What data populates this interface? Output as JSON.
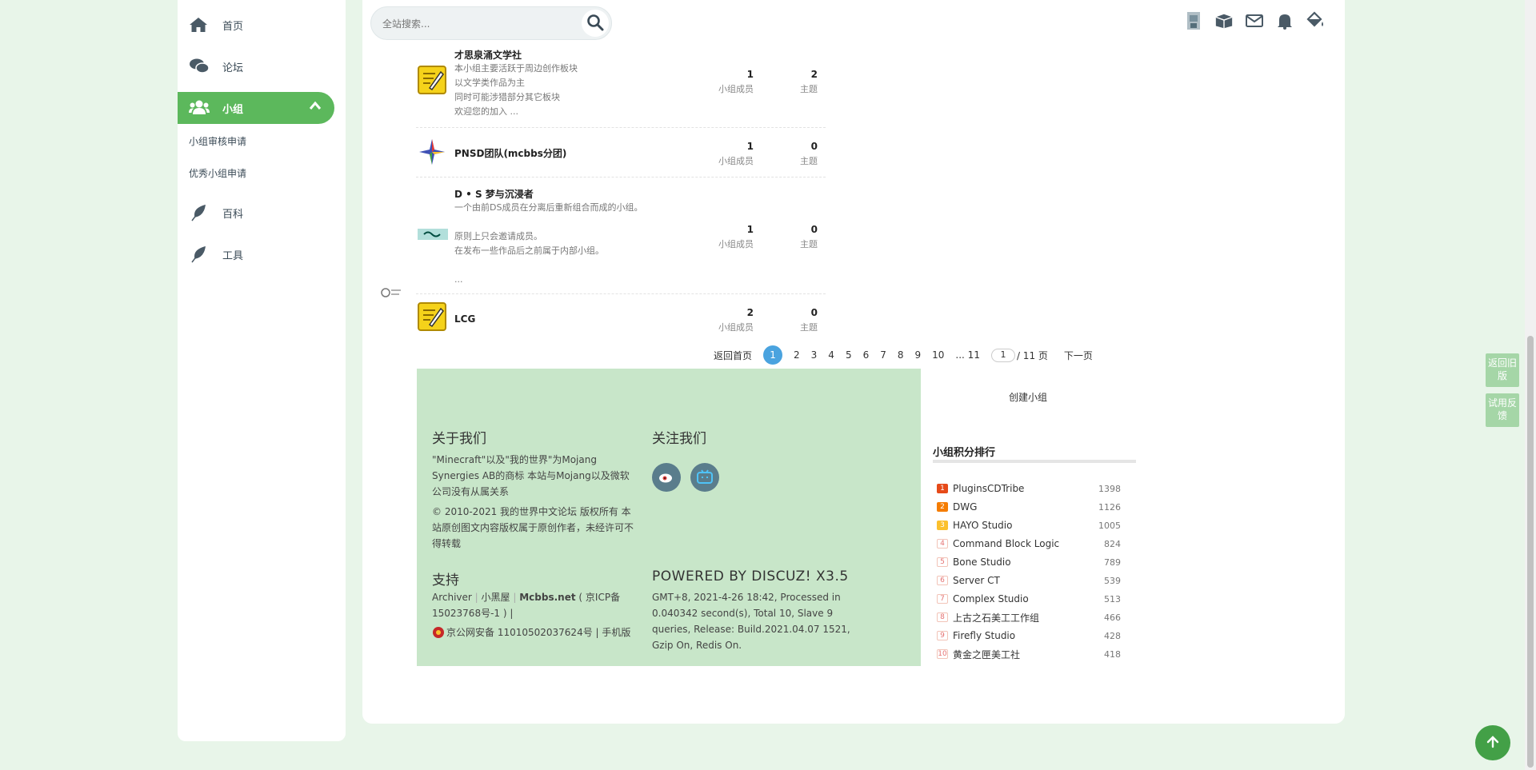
{
  "sidebar": {
    "items": [
      {
        "label": "首页",
        "icon": "home-icon"
      },
      {
        "label": "论坛",
        "icon": "chat-icon"
      },
      {
        "label": "小组",
        "icon": "users-icon"
      },
      {
        "label": "百科",
        "icon": "feather-icon"
      },
      {
        "label": "工具",
        "icon": "feather-icon"
      }
    ],
    "subitems": [
      "小组审核申请",
      "优秀小组申请"
    ]
  },
  "search": {
    "placeholder": "全站搜索..."
  },
  "groups": [
    {
      "name": "才思泉涌文学社",
      "desc": "本小组主要活跃于周边创作板块\n以文学类作品为主\n同时可能涉猎部分其它板块\n欢迎您的加入 ...",
      "members": "1",
      "members_label": "小组成员",
      "topics": "2",
      "topics_label": "主题"
    },
    {
      "name": "PNSD团队(mcbbs分团)",
      "desc": "",
      "members": "1",
      "members_label": "小组成员",
      "topics": "0",
      "topics_label": "主题"
    },
    {
      "name": "D • S 梦与沉浸者",
      "desc": "一个由前DS成员在分离后重新组合而成的小组。\n\n原则上只会邀请成员。\n在发布一些作品后之前属于内部小组。\n\n...",
      "members": "1",
      "members_label": "小组成员",
      "topics": "0",
      "topics_label": "主题"
    },
    {
      "name": "LCG",
      "desc": "",
      "members": "2",
      "members_label": "小组成员",
      "topics": "0",
      "topics_label": "主题"
    }
  ],
  "pager": {
    "home": "返回首页",
    "current": "1",
    "pages": [
      "2",
      "3",
      "4",
      "5",
      "6",
      "7",
      "8",
      "9",
      "10"
    ],
    "last": "... 11",
    "input_value": "1",
    "total": "/ 11 页",
    "next": "下一页"
  },
  "footer": {
    "about_title": "关于我们",
    "about_text1": "\"Minecraft\"以及\"我的世界\"为Mojang Synergies AB的商标 本站与Mojang以及微软公司没有从属关系",
    "about_text2": "© 2010-2021 我的世界中文论坛 版权所有 本站原创图文内容版权属于原创作者，未经许可不得转载",
    "follow_title": "关注我们",
    "support_title": "支持",
    "support_links": [
      "Archiver",
      "小黑屋",
      "Mcbbs.net"
    ],
    "icp": "( 京ICP备15023768号-1 ) |",
    "police": "京公网安备 11010502037624号 | 手机版",
    "powered": "POWERED BY DISCUZ! X3.5",
    "stats": "GMT+8, 2021-4-26 18:42, Processed in 0.040342 second(s), Total 10, Slave 9 queries, Release: Build.2021.04.07 1521, Gzip On, Redis On."
  },
  "create_group": "创建小组",
  "ranking": {
    "title": "小组积分排行",
    "rows": [
      {
        "rank": "1",
        "name": "PluginsCDTribe",
        "score": "1398"
      },
      {
        "rank": "2",
        "name": "DWG",
        "score": "1126"
      },
      {
        "rank": "3",
        "name": "HAYO Studio",
        "score": "1005"
      },
      {
        "rank": "4",
        "name": "Command Block Logic",
        "score": "824"
      },
      {
        "rank": "5",
        "name": "Bone Studio",
        "score": "789"
      },
      {
        "rank": "6",
        "name": "Server CT",
        "score": "539"
      },
      {
        "rank": "7",
        "name": "Complex Studio",
        "score": "513"
      },
      {
        "rank": "8",
        "name": "上古之石美工工作组",
        "score": "466"
      },
      {
        "rank": "9",
        "name": "Firefly Studio",
        "score": "428"
      },
      {
        "rank": "10",
        "name": "黄金之匣美工社",
        "score": "418"
      }
    ]
  },
  "side_buttons": {
    "old": "返回旧版",
    "feedback": "试用反馈"
  },
  "colors": {
    "accent": "#5cb85c",
    "footer_bg": "#c8e6c9",
    "page_bg": "#e8f5e9",
    "pager_current": "#4aa3df"
  }
}
